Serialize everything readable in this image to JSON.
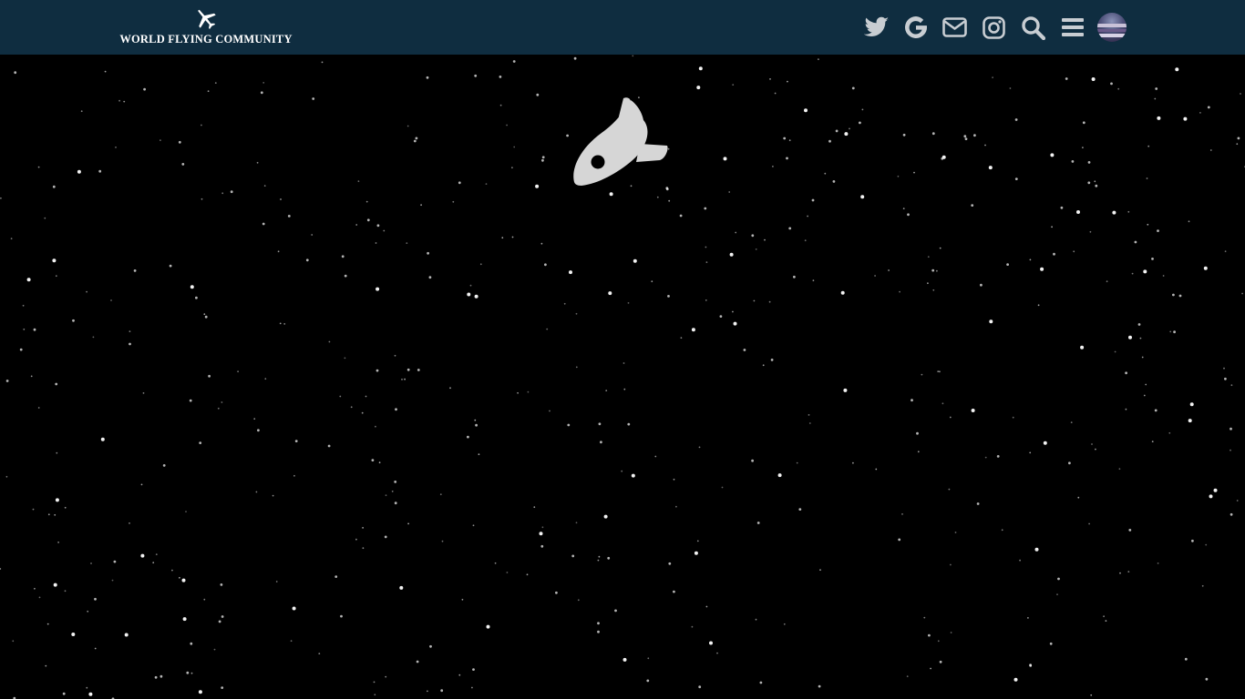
{
  "header": {
    "brand_text": "WORLD FLYING COMMUNITY",
    "brand_icon": "airplane-icon",
    "background_color": "#0f2d40",
    "icon_color": "#c8cdd2",
    "icons": [
      {
        "name": "twitter-icon"
      },
      {
        "name": "google-icon"
      },
      {
        "name": "envelope-icon"
      },
      {
        "name": "instagram-icon"
      },
      {
        "name": "search-icon"
      },
      {
        "name": "menu-icon"
      }
    ],
    "avatar": "user-avatar"
  },
  "main": {
    "background_color": "#000000",
    "illustration": "rocket-icon",
    "rocket_color": "#d6d6d6"
  }
}
